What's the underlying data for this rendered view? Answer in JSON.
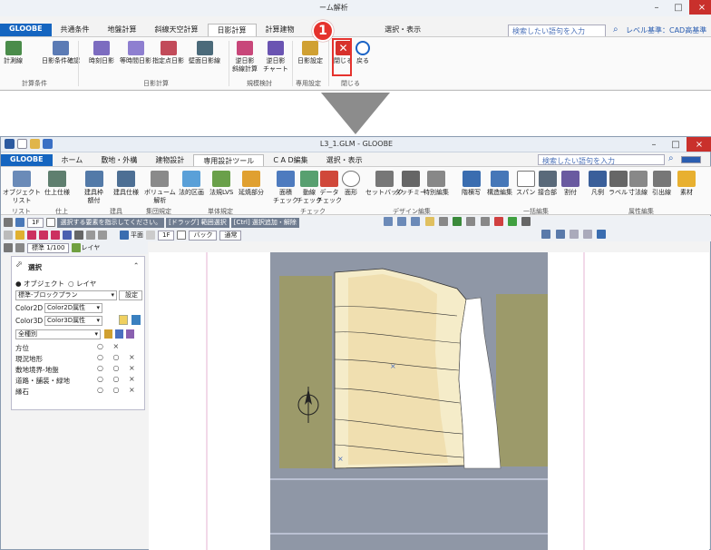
{
  "top": {
    "title_partial": "ーム解析",
    "tabs": [
      "GLOOBE",
      "共通条件",
      "地盤計算",
      "斜線天空計算",
      "日影計算",
      "計算建物",
      "C A",
      "選択・表示"
    ],
    "search_placeholder": "検索したい語句を入力",
    "level_label": "レベル基準：CAD高基準",
    "buttons": [
      "計測線",
      "日影条件確認",
      "時刻日影",
      "等時間日影",
      "指定点日影",
      "壁面日影線",
      "逆日影\n斜線計算",
      "逆日影\nチャート",
      "日影設定",
      "閉じる",
      "戻る"
    ],
    "groups": [
      "計算条件",
      "日影計算",
      "規模検討",
      "専用設定",
      "閉じる"
    ],
    "callout_number": "1"
  },
  "main": {
    "title": "L3_1.GLM - GLOOBE",
    "tabs": [
      "GLOOBE",
      "ホーム",
      "敷地・外構",
      "建物設計",
      "専用設計ツール",
      "C A D編集",
      "選択・表示"
    ],
    "search_placeholder": "検索したい語句を入力",
    "buttons": [
      "オブジェクト\nリスト",
      "仕上仕様",
      "建具枠\n額付",
      "建具仕様",
      "ボリューム\n解析",
      "法的区画",
      "法規LVS",
      "延焼部分",
      "面積\nチェック",
      "動線\nチェック",
      "データ\nチェック",
      "面形",
      "セットバック",
      "タッチミー",
      "特別編集",
      "階横写",
      "構造編集",
      "スパン",
      "接合部",
      "割付",
      "凡例",
      "ラベル",
      "寸法線",
      "引出線",
      "素材"
    ],
    "groups": [
      "リスト",
      "仕上",
      "建具",
      "集団規定",
      "単体規定",
      "チェック",
      "デザイン編集",
      "一括編集",
      "属性編集"
    ],
    "toolbar1": {
      "floor": "1F",
      "hint1": "選択する要素を指示してください。",
      "hint2": "[ドラッグ] 範囲選択",
      "hint3": "[Ctrl] 選択追加・解除"
    },
    "toolbar2": {
      "view_label": "平面",
      "floor": "1F",
      "back": "バック",
      "mode": "通常"
    },
    "toolbar3": {
      "scale": "標準 1/100",
      "layer": "レイヤ"
    }
  },
  "panel": {
    "title": "選択",
    "radio_object": "オブジェクト",
    "radio_layer": "レイヤ",
    "preset": "標準-ブロックプラン",
    "preset_button": "設定",
    "color2d_label": "Color2D",
    "color2d_value": "Color2D属性",
    "color3d_label": "Color3D",
    "color3d_value": "Color3D属性",
    "filter": "全種別",
    "rows": [
      {
        "label": "方位",
        "marks": "○  ×"
      },
      {
        "label": "現況地形",
        "marks": "○ ○ ×"
      },
      {
        "label": "敷地境界-地盤",
        "marks": "○ ○ ×"
      },
      {
        "label": "道路・舗装・緑地",
        "marks": "○ ○ ×"
      },
      {
        "label": "縁石",
        "marks": "○ ○ ×"
      }
    ]
  },
  "colors": {
    "brand_tab": "#1565c0",
    "callout": "#e5322d",
    "road": "#8f97a6",
    "site": "#f5ecc9",
    "green": "#9c9a6a"
  }
}
